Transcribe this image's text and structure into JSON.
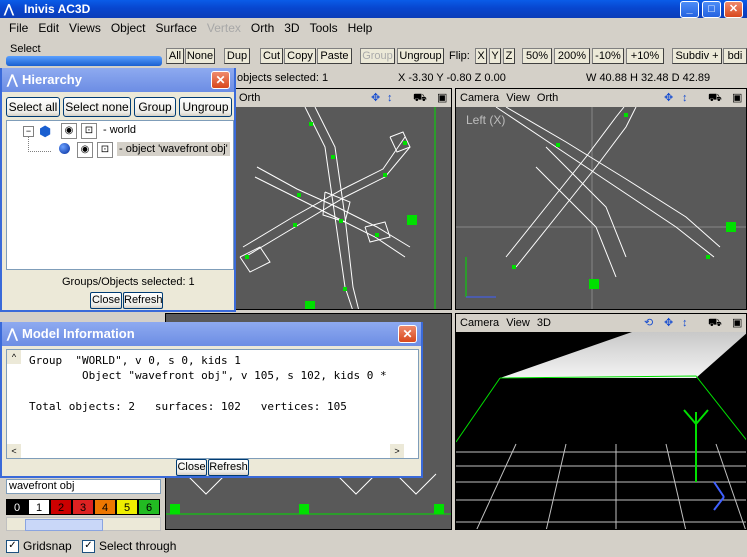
{
  "window": {
    "title": "Inivis AC3D"
  },
  "menu": [
    {
      "label": "File",
      "enabled": true
    },
    {
      "label": "Edit",
      "enabled": true
    },
    {
      "label": "Views",
      "enabled": true
    },
    {
      "label": "Object",
      "enabled": true
    },
    {
      "label": "Surface",
      "enabled": true
    },
    {
      "label": "Vertex",
      "enabled": false
    },
    {
      "label": "Orth",
      "enabled": true
    },
    {
      "label": "3D",
      "enabled": true
    },
    {
      "label": "Tools",
      "enabled": true
    },
    {
      "label": "Help",
      "enabled": true
    }
  ],
  "toolbar": {
    "select_label": "Select",
    "all": "All",
    "none": "None",
    "dup": "Dup",
    "cut": "Cut",
    "copy": "Copy",
    "paste": "Paste",
    "group": "Group",
    "ungroup": "Ungroup",
    "flip_label": "Flip:",
    "flip_x": "X",
    "flip_y": "Y",
    "flip_z": "Z",
    "zoom_50": "50%",
    "zoom_200": "200%",
    "minus10": "-10%",
    "plus10": "+10%",
    "subdiv": "Subdiv +",
    "bdi": "bdi"
  },
  "statusbar": {
    "objects_selected": "objects selected: 1",
    "coords": "X -3.30 Y -0.80 Z 0.00",
    "dims": "W 40.88 H 32.48 D 42.89"
  },
  "viewports": {
    "top_left": {
      "label": "Orth"
    },
    "top_right": {
      "camera": "Camera",
      "view": "View",
      "mode": "Orth",
      "overlay": "Left (X)"
    },
    "bottom_right": {
      "camera": "Camera",
      "view": "View",
      "mode": "3D"
    }
  },
  "hierarchy": {
    "title": "Hierarchy",
    "select_all": "Select all",
    "select_none": "Select none",
    "group": "Group",
    "ungroup": "Ungroup",
    "world": "- world",
    "object": "- object 'wavefront obj'",
    "groups_selected": "Groups/Objects selected: 1",
    "close": "Close",
    "refresh": "Refresh"
  },
  "model_info": {
    "title": "Model Information",
    "line1": "Group  \"WORLD\", v 0, s 0, kids 1",
    "line2": "        Object \"wavefront obj\", v 105, s 102, kids 0 *",
    "line3": "Total objects: 2   surfaces: 102   vertices: 105",
    "close": "Close",
    "refresh": "Refresh"
  },
  "left_panel": {
    "object_name": "wavefront obj",
    "colors": [
      {
        "label": "0",
        "bg": "#000000",
        "fg": "#ffffff"
      },
      {
        "label": "1",
        "bg": "#ffffff",
        "fg": "#000000"
      },
      {
        "label": "2",
        "bg": "#cc0000",
        "fg": "#000000"
      },
      {
        "label": "3",
        "bg": "#dd2222",
        "fg": "#000000"
      },
      {
        "label": "4",
        "bg": "#ee7700",
        "fg": "#000000"
      },
      {
        "label": "5",
        "bg": "#eeee00",
        "fg": "#000000"
      },
      {
        "label": "6",
        "bg": "#22bb22",
        "fg": "#000000"
      }
    ]
  },
  "bottom": {
    "gridsnap": "Gridsnap",
    "select_through": "Select through"
  },
  "colors": {
    "wire": "#ffffff",
    "selected": "#00e000",
    "viewport": "#595959",
    "titlebar": "#0a5ce8"
  }
}
